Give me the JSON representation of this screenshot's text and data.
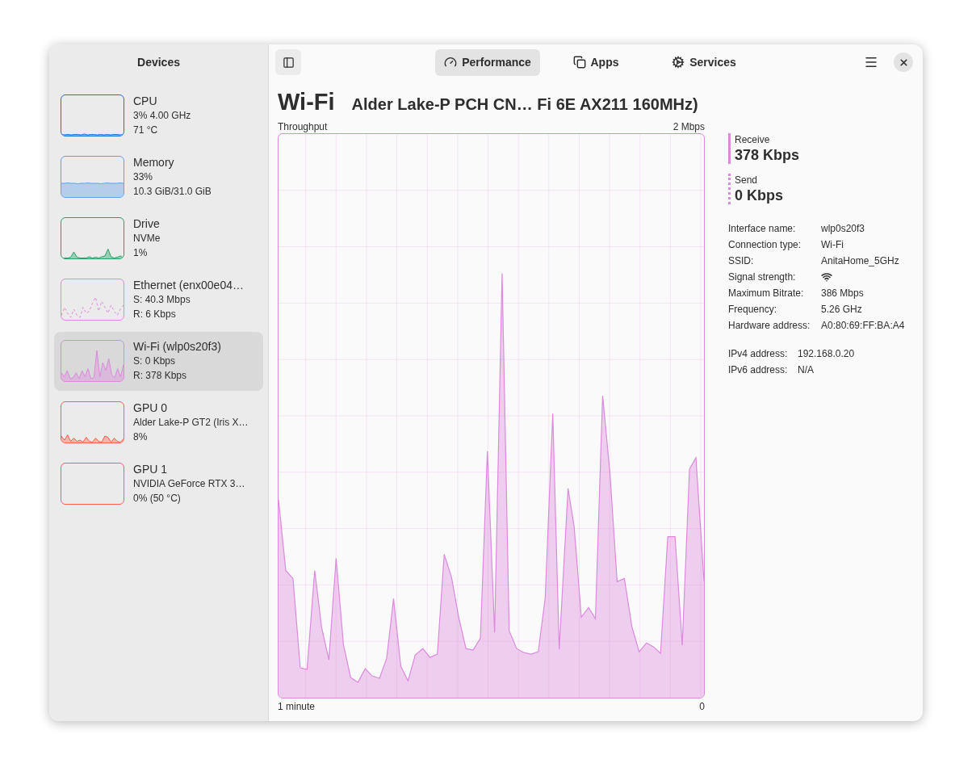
{
  "sidebar": {
    "title": "Devices",
    "devices": [
      {
        "name": "CPU",
        "details": [
          "3% 4.00 GHz",
          "71 °C"
        ],
        "color": "#1c71d8",
        "selected": false
      },
      {
        "name": "Memory",
        "details": [
          "33%",
          "10.3 GiB/31.0 GiB"
        ],
        "color": "#62a0ea",
        "selected": false
      },
      {
        "name": "Drive",
        "details": [
          "NVMe",
          "1%"
        ],
        "color": "#26a269",
        "selected": false
      },
      {
        "name": "Ethernet (enx00e04…",
        "details": [
          "S: 40.3 Mbps",
          "R: 6 Kbps"
        ],
        "color": "#dc8add",
        "selected": false
      },
      {
        "name": "Wi-Fi (wlp0s20f3)",
        "details": [
          "S: 0 Kbps",
          "R: 378 Kbps"
        ],
        "color": "#dc8add",
        "selected": true
      },
      {
        "name": "GPU 0",
        "details": [
          "Alder Lake-P GT2 (Iris X…",
          "8%"
        ],
        "color": "#f66151",
        "selected": false
      },
      {
        "name": "GPU 1",
        "details": [
          "NVIDIA GeForce RTX 3…",
          "0% (50 °C)"
        ],
        "color": "#f66151",
        "selected": false
      }
    ]
  },
  "tabs": [
    {
      "label": "Performance",
      "selected": true
    },
    {
      "label": "Apps",
      "selected": false
    },
    {
      "label": "Services",
      "selected": false
    }
  ],
  "title": "Wi-Fi",
  "subtitle": "Alder Lake-P PCH CN… Fi 6E AX211 160MHz)",
  "graph": {
    "title": "Throughput",
    "max_label": "2 Mbps",
    "start_label": "1 minute",
    "end_label": "0"
  },
  "stats": [
    {
      "label": "Receive",
      "value": "378 Kbps",
      "kind": "solid"
    },
    {
      "label": "Send",
      "value": "0 Kbps",
      "kind": "dotted"
    }
  ],
  "details": [
    {
      "label": "Interface name:",
      "value": "wlp0s20f3",
      "kind": "text"
    },
    {
      "label": "Connection type:",
      "value": "Wi-Fi",
      "kind": "text"
    },
    {
      "label": "SSID:",
      "value": "AnitaHome_5GHz",
      "kind": "text"
    },
    {
      "label": "Signal strength:",
      "kind": "signal"
    },
    {
      "label": "Maximum Bitrate:",
      "value": "386 Mbps",
      "kind": "text"
    },
    {
      "label": "Frequency:",
      "value": "5.26 GHz",
      "kind": "text"
    },
    {
      "label": "Hardware address:",
      "value": "A0:80:69:FF:BA:A4",
      "kind": "text"
    }
  ],
  "addresses": [
    {
      "label": "IPv4 address:",
      "value": "192.168.0.20"
    },
    {
      "label": "IPv6 address:",
      "value": "N/A"
    }
  ]
}
